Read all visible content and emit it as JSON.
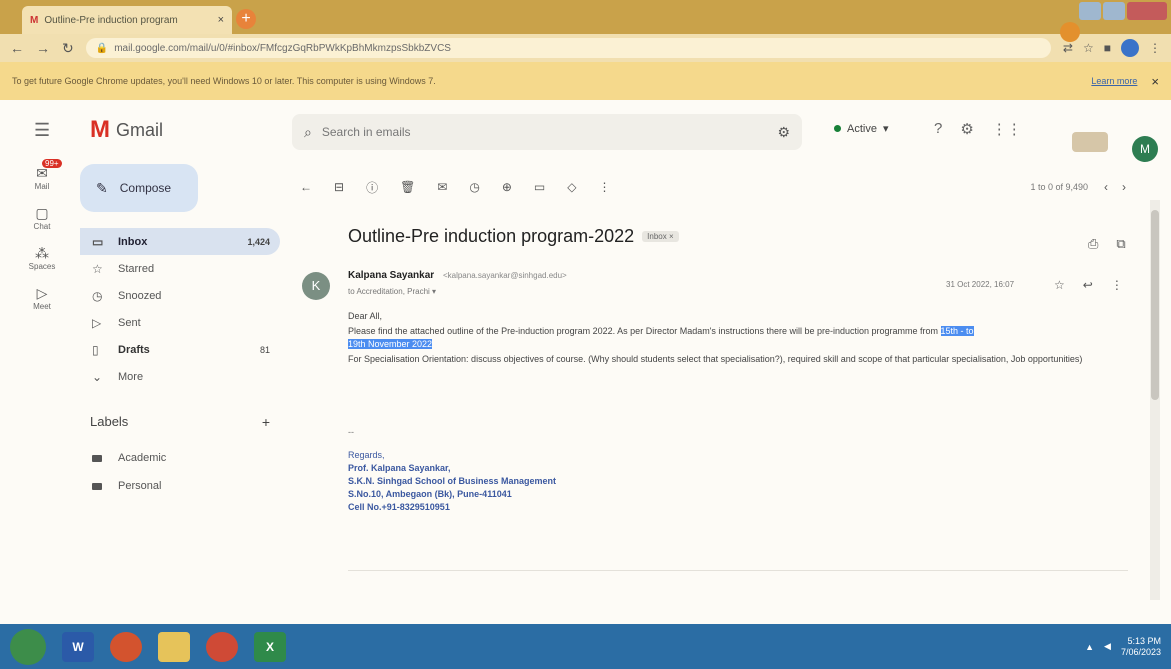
{
  "browser": {
    "tab_title": "Outline-Pre induction program",
    "tab_favicon": "M",
    "tab_close": "×",
    "new_tab": "+",
    "url": "mail.google.com/mail/u/0/#inbox/FMfcgzGqRbPWkKpBhMkmzpsSbkbZVCS",
    "infobar_text": "To get future Google Chrome updates, you'll need Windows 10 or later. This computer is using Windows 7.",
    "infobar_learn": "Learn more",
    "infobar_close": "×"
  },
  "gmail": {
    "logo_text": "Gmail",
    "search_placeholder": "Search in emails",
    "status": "Active",
    "avatar_letter": "M"
  },
  "rail": [
    {
      "label": "Mail",
      "icon": "mail-icon",
      "badge": "99+"
    },
    {
      "label": "Chat",
      "icon": "chat-icon"
    },
    {
      "label": "Spaces",
      "icon": "spaces-icon"
    },
    {
      "label": "Meet",
      "icon": "meet-icon"
    }
  ],
  "sidebar": {
    "compose": "Compose",
    "items": [
      {
        "label": "Inbox",
        "count": "1,424",
        "icon": "inbox-icon"
      },
      {
        "label": "Starred",
        "count": "",
        "icon": "star-icon"
      },
      {
        "label": "Snoozed",
        "count": "",
        "icon": "clock-icon"
      },
      {
        "label": "Sent",
        "count": "",
        "icon": "send-icon"
      },
      {
        "label": "Drafts",
        "count": "81",
        "icon": "draft-icon"
      },
      {
        "label": "More",
        "count": "",
        "icon": "chevron-down-icon"
      }
    ],
    "labels_title": "Labels",
    "labels": [
      "Academic",
      "Personal"
    ]
  },
  "toolbar": {
    "pager": "1 to 0 of 9,490"
  },
  "email": {
    "subject": "Outline-Pre induction program-2022",
    "subject_chip": "Inbox ×",
    "sender_initial": "K",
    "sender_name": "Kalpana Sayankar",
    "sender_email": "<kalpana.sayankar@sinhgad.edu>",
    "to_line": "to Accreditation, Prachi ▾",
    "date": "31 Oct 2022, 16:07",
    "greeting": "Dear All,",
    "line1_pre": "Please find the attached outline of the Pre-induction program 2022. As per Director Madam's instructions there will be pre-induction programme from ",
    "line1_hl1": "15th - to",
    "line1_hl2": "19th November 2022",
    "line2": "For Specialisation Orientation: discuss objectives of course. (Why should students select that specialisation?), required skill and scope of that particular specialisation, Job opportunities)",
    "sig_dash": "--",
    "sig_regards": "Regards,",
    "sig_name": "Prof. Kalpana Sayankar,",
    "sig_org": "S.K.N. Sinhgad School of Business Management",
    "sig_addr": "S.No.10, Ambegaon (Bk), Pune-411041",
    "sig_cell": "Cell No.+91-8329510951"
  },
  "taskbar": {
    "word_label": "W",
    "excel_label": "X",
    "time": "5:13 PM",
    "date": "7/06/2023"
  }
}
